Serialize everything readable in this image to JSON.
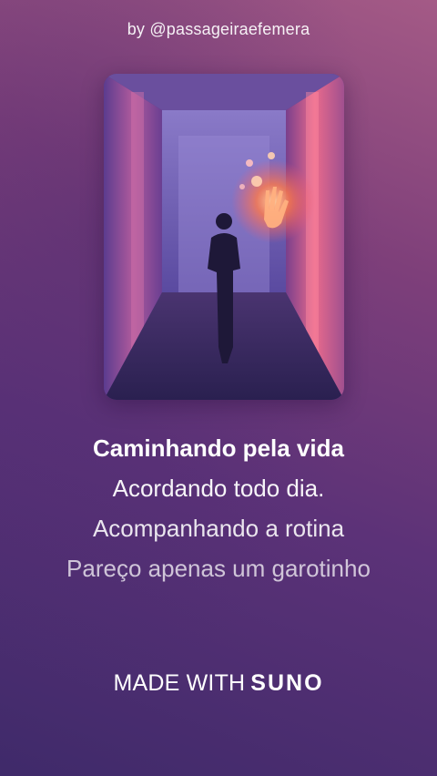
{
  "header": {
    "byline": "by @passageiraefemera"
  },
  "cover": {
    "description_icon": "cover-art-image"
  },
  "lyrics": {
    "lines": [
      "Caminhando pela vida",
      "Acordando todo dia.",
      "Acompanhando a rotina",
      "Pareço apenas um garotinho"
    ],
    "current_index": 0
  },
  "footer": {
    "made_with": "MADE WITH",
    "brand": "SUNO"
  },
  "colors": {
    "background_top": "#a45a86",
    "background_bottom": "#3f2a6a",
    "text": "#ffffff",
    "glow": "#ff7a4a"
  }
}
